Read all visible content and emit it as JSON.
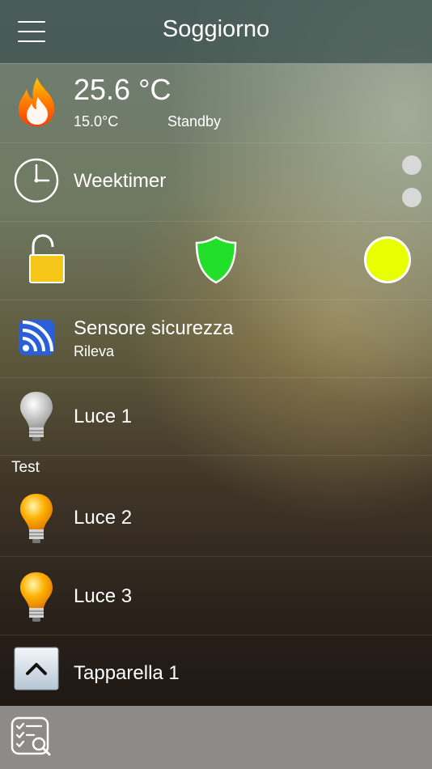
{
  "header": {
    "title": "Soggiorno"
  },
  "thermostat": {
    "temperature": "25.6 °C",
    "setpoint": "15.0°C",
    "mode": "Standby"
  },
  "weektimer": {
    "label": "Weektimer"
  },
  "security": {
    "lock": "unlocked",
    "shield_color": "#22e02a",
    "status_color": "#e8ff00"
  },
  "sensor": {
    "label": "Sensore sicurezza",
    "status": "Rileva"
  },
  "lights": [
    {
      "label": "Luce 1",
      "state": "off"
    },
    {
      "label": "Luce 2",
      "state": "on"
    },
    {
      "label": "Luce 3",
      "state": "on"
    }
  ],
  "section": {
    "title": "Test"
  },
  "shutter": {
    "label": "Tapparella 1"
  },
  "colors": {
    "flame": "#ff6a00",
    "padlock": "#f5c518",
    "bulb_on": "#ffb000",
    "bulb_off": "#b9b9b9",
    "footer": "#8d8a88"
  }
}
